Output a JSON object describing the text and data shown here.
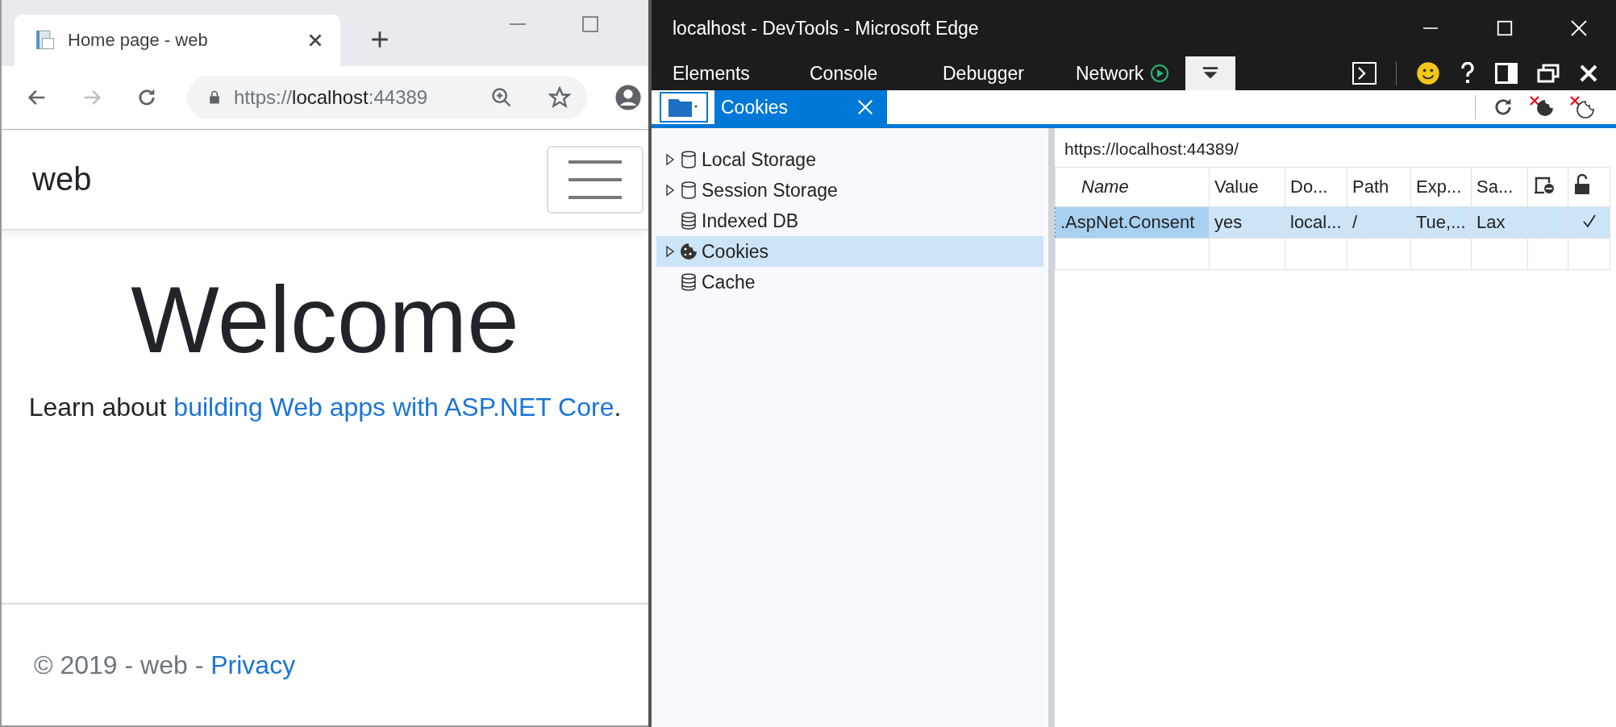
{
  "browser": {
    "tab": {
      "title": "Home page - web"
    },
    "address": {
      "scheme": "https://",
      "host": "localhost",
      "port": ":44389"
    },
    "forward_disabled": true,
    "page": {
      "brand": "web",
      "heading": "Welcome",
      "intro_before": "Learn about ",
      "intro_link": "building Web apps with ASP.NET Core",
      "intro_after": ".",
      "footer_text": "© 2019 - web - ",
      "footer_link": "Privacy"
    }
  },
  "devtools": {
    "window": {
      "title": "localhost - DevTools - Microsoft Edge"
    },
    "tabs": [
      {
        "kind": "text",
        "label": "Elements",
        "selected": false
      },
      {
        "kind": "text",
        "label": "Console",
        "selected": false
      },
      {
        "kind": "text",
        "label": "Debugger",
        "selected": false
      },
      {
        "kind": "recording",
        "label": "Network",
        "selected": false
      },
      {
        "kind": "icon",
        "selected": true
      }
    ],
    "panel_tab": {
      "label": "Cookies",
      "selected": true
    },
    "tree": [
      {
        "label": "Local Storage",
        "kind": "storage",
        "expandable": true,
        "selected": false
      },
      {
        "label": "Session Storage",
        "kind": "storage",
        "expandable": true,
        "selected": false
      },
      {
        "label": "Indexed DB",
        "kind": "database",
        "expandable": false,
        "selected": false
      },
      {
        "label": "Cookies",
        "kind": "cookie",
        "expandable": true,
        "selected": true
      },
      {
        "label": "Cache",
        "kind": "database",
        "expandable": false,
        "selected": false
      }
    ],
    "origin": "https://localhost:44389/",
    "table": {
      "columns": [
        {
          "kind": "text",
          "label": "Name"
        },
        {
          "kind": "text",
          "label": "Value"
        },
        {
          "kind": "text",
          "label": "Do..."
        },
        {
          "kind": "text",
          "label": "Path"
        },
        {
          "kind": "text",
          "label": "Exp..."
        },
        {
          "kind": "text",
          "label": "Sa..."
        },
        {
          "kind": "http-only"
        },
        {
          "kind": "secure"
        }
      ],
      "rows": [
        {
          "selected": true,
          "cells": [
            ".AspNet.Consent",
            "yes",
            "local...",
            "/",
            "Tue,...",
            "Lax"
          ],
          "http_only": false,
          "secure": true
        }
      ]
    }
  }
}
